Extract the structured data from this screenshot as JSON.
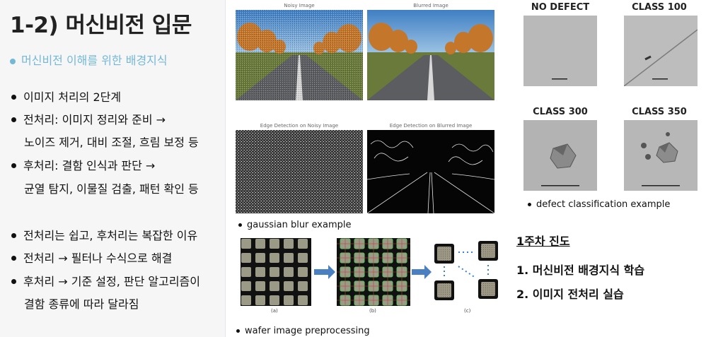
{
  "title": "1-2) 머신비전 입문",
  "subtitle": "머신비전 이해를 위한 배경지식",
  "left_bullets": {
    "b1": "이미지 처리의 2단계",
    "b2": "전처리: 이미지 정리와 준비 →",
    "b2_cont": "노이즈 제거, 대비 조절, 흐림 보정 등",
    "b3": "후처리: 결함 인식과 판단 →",
    "b3_cont": "균열 탐지, 이물질 검출, 패턴 확인 등",
    "b4": "전처리는 쉽고, 후처리는 복잡한 이유",
    "b5": "전처리 → 필터나 수식으로 해결",
    "b6": "후처리 → 기준 설정, 판단 알고리즘이",
    "b6_cont": "결함 종류에 따라 달라짐"
  },
  "figure_blur": {
    "noisy_label": "Noisy Image",
    "blurred_label": "Blurred Image",
    "edge_noisy_label": "Edge Detection on Noisy Image",
    "edge_blurred_label": "Edge Detection on Blurred Image",
    "caption": "gaussian blur example"
  },
  "figure_wafer": {
    "label_a": "(a)",
    "label_b": "(b)",
    "label_c": "(c)",
    "caption": "wafer image preprocessing"
  },
  "figure_defect": {
    "class_no_defect": "NO DEFECT",
    "class_100": "CLASS 100",
    "class_300": "CLASS 300",
    "class_350": "CLASS 350",
    "caption": "defect classification example"
  },
  "progress": {
    "title": "1주차 진도",
    "item1": "1. 머신비전 배경지식 학습",
    "item2": "2. 이미지 전처리 실습"
  },
  "colors": {
    "accent": "#74b8d8",
    "arrow_blue": "#4a7fc1",
    "left_bg": "#f6f6f7"
  }
}
